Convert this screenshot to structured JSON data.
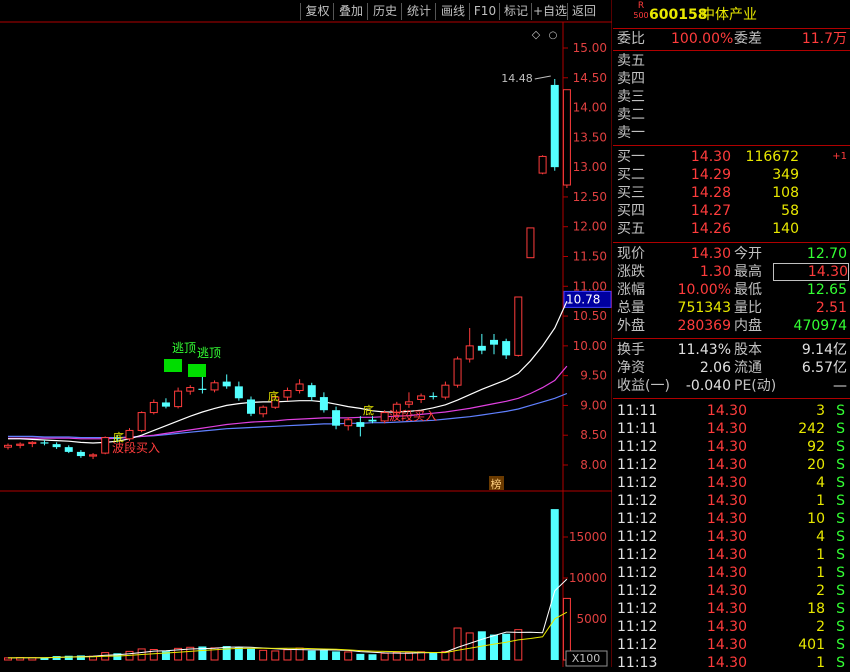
{
  "toolbar": {
    "buttons": [
      "复权",
      "叠加",
      "历史",
      "统计",
      "画线",
      "F10",
      "标记",
      "+自选",
      "返回"
    ]
  },
  "stock": {
    "badge_top": "R",
    "badge_bottom": "500",
    "code": "600158",
    "name": "中体产业"
  },
  "order_book": {
    "weibi_label": "委比",
    "weibi_value": "100.00%",
    "weicha_label": "委差",
    "weicha_value": "11.7万",
    "sells": [
      {
        "label": "卖五",
        "price": "",
        "vol": ""
      },
      {
        "label": "卖四",
        "price": "",
        "vol": ""
      },
      {
        "label": "卖三",
        "price": "",
        "vol": ""
      },
      {
        "label": "卖二",
        "price": "",
        "vol": ""
      },
      {
        "label": "卖一",
        "price": "",
        "vol": ""
      }
    ],
    "buys": [
      {
        "label": "买一",
        "price": "14.30",
        "vol": "116672",
        "chg": "+1"
      },
      {
        "label": "买二",
        "price": "14.29",
        "vol": "349",
        "chg": ""
      },
      {
        "label": "买三",
        "price": "14.28",
        "vol": "108",
        "chg": ""
      },
      {
        "label": "买四",
        "price": "14.27",
        "vol": "58",
        "chg": ""
      },
      {
        "label": "买五",
        "price": "14.26",
        "vol": "140",
        "chg": ""
      }
    ]
  },
  "quote": {
    "rows": [
      {
        "l1": "现价",
        "v1": "14.30",
        "c1": "red",
        "l2": "今开",
        "v2": "12.70",
        "c2": "grn",
        "boxed": false
      },
      {
        "l1": "涨跌",
        "v1": "1.30",
        "c1": "red",
        "l2": "最高",
        "v2": "14.30",
        "c2": "red",
        "boxed": true
      },
      {
        "l1": "涨幅",
        "v1": "10.00%",
        "c1": "red",
        "l2": "最低",
        "v2": "12.65",
        "c2": "grn",
        "boxed": false
      },
      {
        "l1": "总量",
        "v1": "751343",
        "c1": "yel",
        "l2": "量比",
        "v2": "2.51",
        "c2": "red",
        "boxed": false
      },
      {
        "l1": "外盘",
        "v1": "280369",
        "c1": "red",
        "l2": "内盘",
        "v2": "470974",
        "c2": "grn",
        "boxed": false
      }
    ],
    "rows2": [
      {
        "l1": "换手",
        "v1": "11.43%",
        "l2": "股本",
        "v2": "9.14亿"
      },
      {
        "l1": "净资",
        "v1": "2.06",
        "l2": "流通",
        "v2": "6.57亿"
      },
      {
        "l1": "收益(一)",
        "v1": "-0.040",
        "l2": "PE(动)",
        "v2": "—"
      }
    ]
  },
  "ticks": [
    {
      "time": "11:11",
      "price": "14.30",
      "vol": "3",
      "side": "S"
    },
    {
      "time": "11:11",
      "price": "14.30",
      "vol": "242",
      "side": "S"
    },
    {
      "time": "11:12",
      "price": "14.30",
      "vol": "92",
      "side": "S"
    },
    {
      "time": "11:12",
      "price": "14.30",
      "vol": "20",
      "side": "S"
    },
    {
      "time": "11:12",
      "price": "14.30",
      "vol": "4",
      "side": "S"
    },
    {
      "time": "11:12",
      "price": "14.30",
      "vol": "1",
      "side": "S"
    },
    {
      "time": "11:12",
      "price": "14.30",
      "vol": "10",
      "side": "S"
    },
    {
      "time": "11:12",
      "price": "14.30",
      "vol": "4",
      "side": "S"
    },
    {
      "time": "11:12",
      "price": "14.30",
      "vol": "1",
      "side": "S"
    },
    {
      "time": "11:12",
      "price": "14.30",
      "vol": "1",
      "side": "S"
    },
    {
      "time": "11:12",
      "price": "14.30",
      "vol": "2",
      "side": "S"
    },
    {
      "time": "11:12",
      "price": "14.30",
      "vol": "18",
      "side": "S"
    },
    {
      "time": "11:12",
      "price": "14.30",
      "vol": "2",
      "side": "S"
    },
    {
      "time": "11:12",
      "price": "14.30",
      "vol": "401",
      "side": "S"
    },
    {
      "time": "11:13",
      "price": "14.30",
      "vol": "1",
      "side": "S"
    }
  ],
  "chart": {
    "price_ticks": [
      "15.00",
      "14.50",
      "14.00",
      "13.50",
      "13.00",
      "12.50",
      "12.00",
      "11.50",
      "11.00",
      "10.50",
      "10.00",
      "9.50",
      "9.00",
      "8.50",
      "8.00"
    ],
    "current_price_label": "10.78",
    "high_label": "14.48",
    "vol_ticks": [
      "15000",
      "10000",
      "5000"
    ],
    "vol_unit": "X100",
    "list_marker": "榜",
    "annotations": {
      "escape1": "逃顶",
      "escape2": "逃顶",
      "buy1": "波段买入",
      "buy2": "波段买入",
      "di1": "底",
      "di2": "底",
      "di3": "底"
    }
  },
  "colors": {
    "up": "#ff3c3c",
    "down": "#54ffff",
    "ma_white": "#ffffff",
    "ma_magenta": "#e040e0",
    "ma_blue": "#6080ff"
  },
  "chart_data": {
    "type": "candlestick",
    "ylim": [
      7.8,
      15.2
    ],
    "candles": [
      {
        "o": 8.3,
        "h": 8.36,
        "l": 8.26,
        "c": 8.33
      },
      {
        "o": 8.33,
        "h": 8.38,
        "l": 8.28,
        "c": 8.35
      },
      {
        "o": 8.36,
        "h": 8.4,
        "l": 8.3,
        "c": 8.38
      },
      {
        "o": 8.38,
        "h": 8.42,
        "l": 8.33,
        "c": 8.36
      },
      {
        "o": 8.35,
        "h": 8.38,
        "l": 8.27,
        "c": 8.3
      },
      {
        "o": 8.3,
        "h": 8.33,
        "l": 8.2,
        "c": 8.22
      },
      {
        "o": 8.22,
        "h": 8.25,
        "l": 8.12,
        "c": 8.15
      },
      {
        "o": 8.15,
        "h": 8.2,
        "l": 8.1,
        "c": 8.17
      },
      {
        "o": 8.2,
        "h": 8.48,
        "l": 8.18,
        "c": 8.46
      },
      {
        "o": 8.46,
        "h": 8.5,
        "l": 8.38,
        "c": 8.44
      },
      {
        "o": 8.44,
        "h": 8.62,
        "l": 8.4,
        "c": 8.58
      },
      {
        "o": 8.58,
        "h": 8.9,
        "l": 8.55,
        "c": 8.88
      },
      {
        "o": 8.88,
        "h": 9.1,
        "l": 8.85,
        "c": 9.05
      },
      {
        "o": 9.05,
        "h": 9.12,
        "l": 8.95,
        "c": 8.98
      },
      {
        "o": 8.98,
        "h": 9.3,
        "l": 8.95,
        "c": 9.24
      },
      {
        "o": 9.24,
        "h": 9.34,
        "l": 9.18,
        "c": 9.3
      },
      {
        "o": 9.28,
        "h": 9.62,
        "l": 9.2,
        "c": 9.26
      },
      {
        "o": 9.26,
        "h": 9.42,
        "l": 9.22,
        "c": 9.38
      },
      {
        "o": 9.4,
        "h": 9.52,
        "l": 9.28,
        "c": 9.32
      },
      {
        "o": 9.32,
        "h": 9.4,
        "l": 9.08,
        "c": 9.12
      },
      {
        "o": 9.1,
        "h": 9.15,
        "l": 8.82,
        "c": 8.86
      },
      {
        "o": 8.86,
        "h": 9.0,
        "l": 8.8,
        "c": 8.97
      },
      {
        "o": 8.97,
        "h": 9.18,
        "l": 8.94,
        "c": 9.14
      },
      {
        "o": 9.14,
        "h": 9.3,
        "l": 9.08,
        "c": 9.25
      },
      {
        "o": 9.25,
        "h": 9.44,
        "l": 9.2,
        "c": 9.36
      },
      {
        "o": 9.34,
        "h": 9.38,
        "l": 9.08,
        "c": 9.14
      },
      {
        "o": 9.14,
        "h": 9.22,
        "l": 8.88,
        "c": 8.92
      },
      {
        "o": 8.92,
        "h": 8.98,
        "l": 8.6,
        "c": 8.66
      },
      {
        "o": 8.66,
        "h": 8.8,
        "l": 8.58,
        "c": 8.76
      },
      {
        "o": 8.72,
        "h": 8.82,
        "l": 8.48,
        "c": 8.64
      },
      {
        "o": 8.76,
        "h": 8.82,
        "l": 8.7,
        "c": 8.73
      },
      {
        "o": 8.74,
        "h": 8.92,
        "l": 8.7,
        "c": 8.88
      },
      {
        "o": 8.88,
        "h": 9.06,
        "l": 8.82,
        "c": 9.02
      },
      {
        "o": 9.02,
        "h": 9.22,
        "l": 8.96,
        "c": 9.06
      },
      {
        "o": 9.1,
        "h": 9.2,
        "l": 9.04,
        "c": 9.16
      },
      {
        "o": 9.16,
        "h": 9.22,
        "l": 9.1,
        "c": 9.14
      },
      {
        "o": 9.14,
        "h": 9.4,
        "l": 9.1,
        "c": 9.34
      },
      {
        "o": 9.34,
        "h": 9.82,
        "l": 9.3,
        "c": 9.78
      },
      {
        "o": 9.78,
        "h": 10.3,
        "l": 9.72,
        "c": 10.0
      },
      {
        "o": 10.0,
        "h": 10.2,
        "l": 9.86,
        "c": 9.92
      },
      {
        "o": 10.1,
        "h": 10.2,
        "l": 9.86,
        "c": 10.02
      },
      {
        "o": 10.08,
        "h": 10.12,
        "l": 9.78,
        "c": 9.84
      },
      {
        "o": 9.84,
        "h": 10.82,
        "l": 9.82,
        "c": 10.82
      },
      {
        "o": 11.48,
        "h": 11.98,
        "l": 11.48,
        "c": 11.98
      },
      {
        "o": 12.9,
        "h": 13.2,
        "l": 12.88,
        "c": 13.18
      },
      {
        "o": 14.38,
        "h": 14.48,
        "l": 12.94,
        "c": 13.0
      },
      {
        "o": 12.7,
        "h": 14.3,
        "l": 12.65,
        "c": 14.3
      }
    ],
    "volumes": [
      260,
      300,
      280,
      250,
      480,
      520,
      560,
      460,
      900,
      820,
      1050,
      1350,
      1280,
      1080,
      1420,
      1550,
      1650,
      1480,
      1700,
      1550,
      1380,
      1180,
      1100,
      1250,
      1450,
      1150,
      1200,
      1050,
      980,
      750,
      700,
      820,
      950,
      900,
      1000,
      850,
      1050,
      3900,
      3300,
      3500,
      3100,
      3200,
      3700,
      0,
      0,
      18400,
      7513
    ],
    "ma_white": [
      8.44,
      8.44,
      8.43,
      8.42,
      8.41,
      8.4,
      8.38,
      8.37,
      8.38,
      8.4,
      8.44,
      8.5,
      8.58,
      8.66,
      8.74,
      8.82,
      8.89,
      8.95,
      9.0,
      9.03,
      9.05,
      9.06,
      9.06,
      9.07,
      9.08,
      9.08,
      9.06,
      9.02,
      8.98,
      8.95,
      8.91,
      8.89,
      8.89,
      8.9,
      8.92,
      8.96,
      9.01,
      9.09,
      9.18,
      9.27,
      9.35,
      9.43,
      9.54,
      9.75,
      10.0,
      10.3,
      10.75
    ],
    "ma_magenta": [
      8.45,
      8.45,
      8.45,
      8.45,
      8.45,
      8.45,
      8.44,
      8.44,
      8.44,
      8.45,
      8.46,
      8.48,
      8.5,
      8.53,
      8.56,
      8.59,
      8.62,
      8.65,
      8.68,
      8.7,
      8.72,
      8.73,
      8.74,
      8.76,
      8.77,
      8.78,
      8.79,
      8.79,
      8.79,
      8.8,
      8.8,
      8.81,
      8.82,
      8.83,
      8.85,
      8.87,
      8.89,
      8.92,
      8.95,
      8.99,
      9.03,
      9.07,
      9.12,
      9.2,
      9.3,
      9.42,
      9.66
    ],
    "ma_blue": [
      8.48,
      8.48,
      8.48,
      8.47,
      8.47,
      8.47,
      8.46,
      8.46,
      8.46,
      8.46,
      8.47,
      8.48,
      8.49,
      8.51,
      8.53,
      8.55,
      8.57,
      8.59,
      8.61,
      8.62,
      8.63,
      8.64,
      8.65,
      8.66,
      8.67,
      8.68,
      8.69,
      8.69,
      8.7,
      8.7,
      8.71,
      8.71,
      8.72,
      8.73,
      8.74,
      8.75,
      8.77,
      8.79,
      8.81,
      8.84,
      8.87,
      8.9,
      8.94,
      9.0,
      9.06,
      9.12,
      9.2
    ]
  }
}
